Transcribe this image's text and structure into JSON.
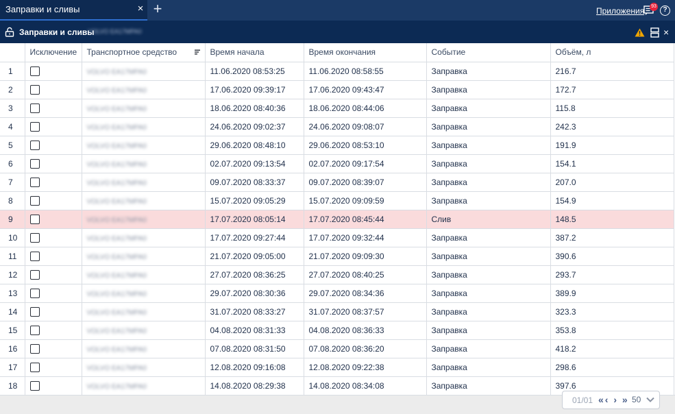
{
  "tabbar": {
    "tab_label": "Заправки и сливы",
    "close_symbol": "×",
    "add_symbol": "+",
    "apps_label": "Приложения",
    "messages_badge": "93",
    "help_symbol": "?"
  },
  "window": {
    "title": "Заправки и сливы",
    "subtitle": "VOLVO EA17MPA0",
    "close_symbol": "×"
  },
  "table": {
    "headers": {
      "index": "",
      "exclusion": "Исключение",
      "vehicle": "Транспортное средство",
      "start": "Время начала",
      "end": "Время окончания",
      "event": "Событие",
      "volume": "Объём, л"
    },
    "rows": [
      {
        "n": "1",
        "vehicle": "VOLVO EA17MPA0",
        "start": "11.06.2020 08:53:25",
        "end": "11.06.2020 08:58:55",
        "event": "Заправка",
        "volume": "216.7"
      },
      {
        "n": "2",
        "vehicle": "VOLVO EA17MPA0",
        "start": "17.06.2020 09:39:17",
        "end": "17.06.2020 09:43:47",
        "event": "Заправка",
        "volume": "172.7"
      },
      {
        "n": "3",
        "vehicle": "VOLVO EA17MPA0",
        "start": "18.06.2020 08:40:36",
        "end": "18.06.2020 08:44:06",
        "event": "Заправка",
        "volume": "115.8"
      },
      {
        "n": "4",
        "vehicle": "VOLVO EA17MPA0",
        "start": "24.06.2020 09:02:37",
        "end": "24.06.2020 09:08:07",
        "event": "Заправка",
        "volume": "242.3"
      },
      {
        "n": "5",
        "vehicle": "VOLVO EA17MPA0",
        "start": "29.06.2020 08:48:10",
        "end": "29.06.2020 08:53:10",
        "event": "Заправка",
        "volume": "191.9"
      },
      {
        "n": "6",
        "vehicle": "VOLVO EA17MPA0",
        "start": "02.07.2020 09:13:54",
        "end": "02.07.2020 09:17:54",
        "event": "Заправка",
        "volume": "154.1"
      },
      {
        "n": "7",
        "vehicle": "VOLVO EA17MPA0",
        "start": "09.07.2020 08:33:37",
        "end": "09.07.2020 08:39:07",
        "event": "Заправка",
        "volume": "207.0"
      },
      {
        "n": "8",
        "vehicle": "VOLVO EA17MPA0",
        "start": "15.07.2020 09:05:29",
        "end": "15.07.2020 09:09:59",
        "event": "Заправка",
        "volume": "154.9"
      },
      {
        "n": "9",
        "vehicle": "VOLVO EA17MPA0",
        "start": "17.07.2020 08:05:14",
        "end": "17.07.2020 08:45:44",
        "event": "Слив",
        "volume": "148.5"
      },
      {
        "n": "10",
        "vehicle": "VOLVO EA17MPA0",
        "start": "17.07.2020 09:27:44",
        "end": "17.07.2020 09:32:44",
        "event": "Заправка",
        "volume": "387.2"
      },
      {
        "n": "11",
        "vehicle": "VOLVO EA17MPA0",
        "start": "21.07.2020 09:05:00",
        "end": "21.07.2020 09:09:30",
        "event": "Заправка",
        "volume": "390.6"
      },
      {
        "n": "12",
        "vehicle": "VOLVO EA17MPA0",
        "start": "27.07.2020 08:36:25",
        "end": "27.07.2020 08:40:25",
        "event": "Заправка",
        "volume": "293.7"
      },
      {
        "n": "13",
        "vehicle": "VOLVO EA17MPA0",
        "start": "29.07.2020 08:30:36",
        "end": "29.07.2020 08:34:36",
        "event": "Заправка",
        "volume": "389.9"
      },
      {
        "n": "14",
        "vehicle": "VOLVO EA17MPA0",
        "start": "31.07.2020 08:33:27",
        "end": "31.07.2020 08:37:57",
        "event": "Заправка",
        "volume": "323.3"
      },
      {
        "n": "15",
        "vehicle": "VOLVO EA17MPA0",
        "start": "04.08.2020 08:31:33",
        "end": "04.08.2020 08:36:33",
        "event": "Заправка",
        "volume": "353.8"
      },
      {
        "n": "16",
        "vehicle": "VOLVO EA17MPA0",
        "start": "07.08.2020 08:31:50",
        "end": "07.08.2020 08:36:20",
        "event": "Заправка",
        "volume": "418.2"
      },
      {
        "n": "17",
        "vehicle": "VOLVO EA17MPA0",
        "start": "12.08.2020 09:16:08",
        "end": "12.08.2020 09:22:38",
        "event": "Заправка",
        "volume": "298.6"
      },
      {
        "n": "18",
        "vehicle": "VOLVO EA17MPA0",
        "start": "14.08.2020 08:29:38",
        "end": "14.08.2020 08:34:08",
        "event": "Заправка",
        "volume": "397.6"
      }
    ],
    "highlight_row_index": 8,
    "highlight_color": "#fadbdc"
  },
  "pager": {
    "page": "01/01",
    "nav_symbols": "«‹ › »",
    "page_size": "50"
  },
  "colors": {
    "tabbar": "#1b3a66",
    "window_header": "#0c2a54",
    "warning": "#f0a500",
    "badge": "#e8243c"
  },
  "icons": [
    "close-icon",
    "plus-icon",
    "messages-icon",
    "help-icon",
    "lock-icon",
    "warning-icon",
    "layout-icon",
    "sort-icon",
    "chevron-down-icon"
  ]
}
